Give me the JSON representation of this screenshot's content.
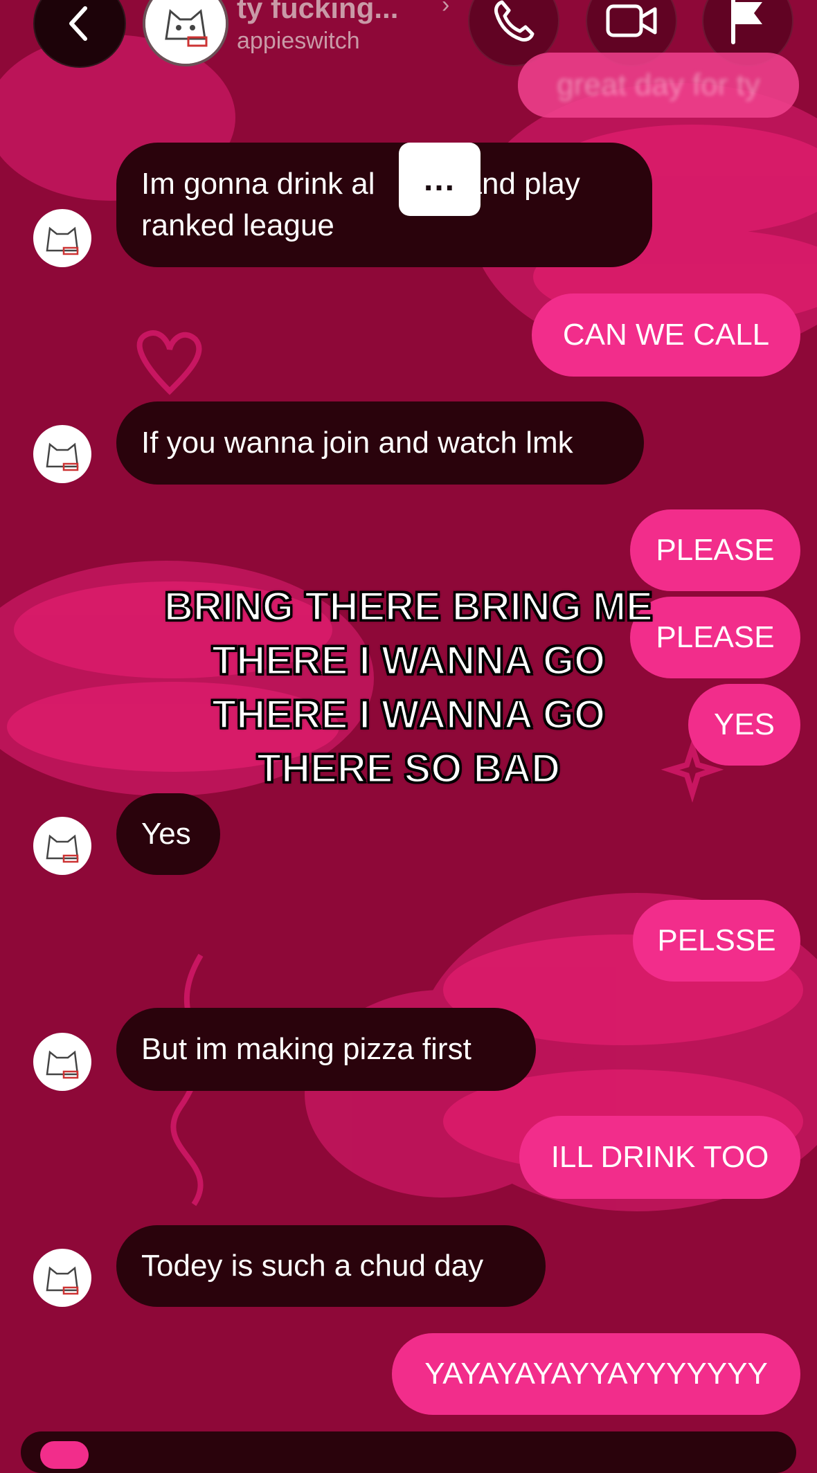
{
  "header": {
    "contact_name": "ty fucking...",
    "chevron": "›",
    "handle": "appieswitch",
    "ghost_message": "great day for ty",
    "icons": [
      "back-icon",
      "phone-icon",
      "video-icon",
      "flag-icon"
    ]
  },
  "colors": {
    "background": "#8e0838",
    "incoming_bubble": "#2a030c",
    "outgoing_bubble": "#f22d8b"
  },
  "typing_indicator": "...",
  "messages": {
    "m1": "Im gonna drink al",
    "m1b": "and play",
    "m1c": "ranked league",
    "m2": "CAN WE CALL",
    "m3": "If you wanna join and watch lmk",
    "m4": "PLEASE",
    "m5": "PLEASE",
    "m6": "YES",
    "m7": "Yes",
    "m8": "PELSSE",
    "m9": "But im making pizza first",
    "m10": "ILL DRINK TOO",
    "m11": "Todey is such a chud day",
    "m12": "YAYAYAYAYYAYYYYYYY"
  },
  "overlay_caption": {
    "line1": "BRING THERE BRING ME",
    "line2": "THERE I WANNA GO",
    "line3": "THERE I WANNA GO",
    "line4": "THERE SO BAD"
  }
}
